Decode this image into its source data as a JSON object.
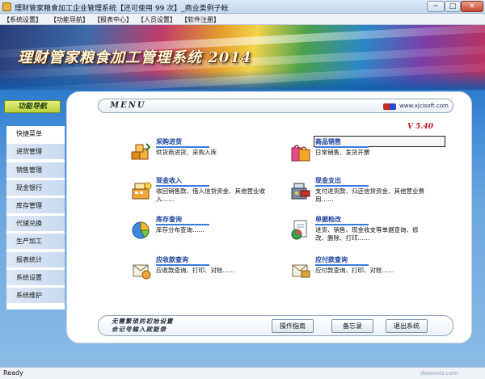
{
  "window": {
    "title": "理财管家粮食加工企业管理系统【还可使用 99 次】_商业类例子帐",
    "buttons": {
      "min": "─",
      "max": "□",
      "close": "✕"
    }
  },
  "menubar": {
    "items": [
      "【系统设置】",
      "【功能导航】",
      "【报表中心】",
      "【人员设置】",
      "【软件注册】"
    ]
  },
  "banner": {
    "title": "理财管家粮食加工管理系统 2014"
  },
  "sidebar": {
    "header": "功能导航",
    "items": [
      "快捷菜单",
      "进货管理",
      "销售管理",
      "现金银行",
      "库存管理",
      "代储兑换",
      "生产加工",
      "报表统计",
      "系统设置",
      "系统维护"
    ],
    "active_index": 0
  },
  "main": {
    "menu_label": "MENU",
    "site": "www.xjcisoft.com",
    "version": "V 5.40",
    "features": [
      {
        "name": "采购进货",
        "desc": "供货商进货、采购入库",
        "icon": "purchase-icon"
      },
      {
        "name": "商品销售",
        "desc": "日常销售、发货开票",
        "icon": "shopping-bag-icon"
      },
      {
        "name": "现金收入",
        "desc": "收回销售款、借入信贷资金、其他营业收入……",
        "icon": "cash-register-icon"
      },
      {
        "name": "现金支出",
        "desc": "支付进货款、归还信贷资金、其他营业费用……",
        "icon": "cash-payment-icon"
      },
      {
        "name": "库存查询",
        "desc": "库存分布查询……",
        "icon": "pie-chart-icon"
      },
      {
        "name": "单据检改",
        "desc": "进货、销售、现金收支等单据查询、修改、删除、打印……",
        "icon": "document-chart-icon"
      },
      {
        "name": "应收款查询",
        "desc": "应收款查询、打印、对账……",
        "icon": "receivable-icon"
      },
      {
        "name": "应付款查询",
        "desc": "应付款查询、打印、对账……",
        "icon": "payable-icon"
      }
    ],
    "motto_line1": "无需繁琐的初始设置",
    "motto_line2": "会记号输入就能录",
    "buttons": {
      "guide": "操作指南",
      "memo": "备忘录",
      "exit": "退出系统"
    }
  },
  "status": {
    "text": "Ready",
    "watermark": "downxia.com"
  },
  "colors": {
    "accent": "#1a3f9a",
    "version": "#c0141c",
    "banner_text": "#fff8d8"
  }
}
